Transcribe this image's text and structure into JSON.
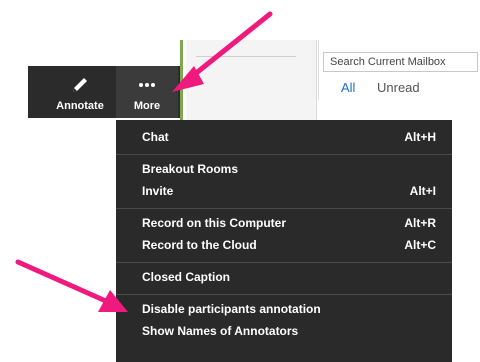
{
  "background": {
    "panel_text": "",
    "search_placeholder": "Search Current Mailbox",
    "filter_all": "All",
    "filter_unread": "Unread"
  },
  "toolbar": {
    "annotate_label": "Annotate",
    "more_label": "More",
    "annotate_icon": "pencil-icon",
    "more_icon": "ellipsis-icon"
  },
  "menu": {
    "items": [
      {
        "label": "Chat",
        "shortcut": "Alt+H"
      },
      {
        "label": "Breakout Rooms",
        "shortcut": ""
      },
      {
        "label": "Invite",
        "shortcut": "Alt+I"
      },
      {
        "label": "Record on this Computer",
        "shortcut": "Alt+R"
      },
      {
        "label": "Record to the Cloud",
        "shortcut": "Alt+C"
      },
      {
        "label": "Closed Caption",
        "shortcut": ""
      },
      {
        "label": "Disable participants annotation",
        "shortcut": ""
      },
      {
        "label": "Show Names of Annotators",
        "shortcut": ""
      }
    ]
  },
  "colors": {
    "arrow": "#f0197d",
    "toolbar_bg": "#2b2b2b",
    "menu_bg": "#2a2a2a",
    "link_blue": "#1f6fc5"
  }
}
